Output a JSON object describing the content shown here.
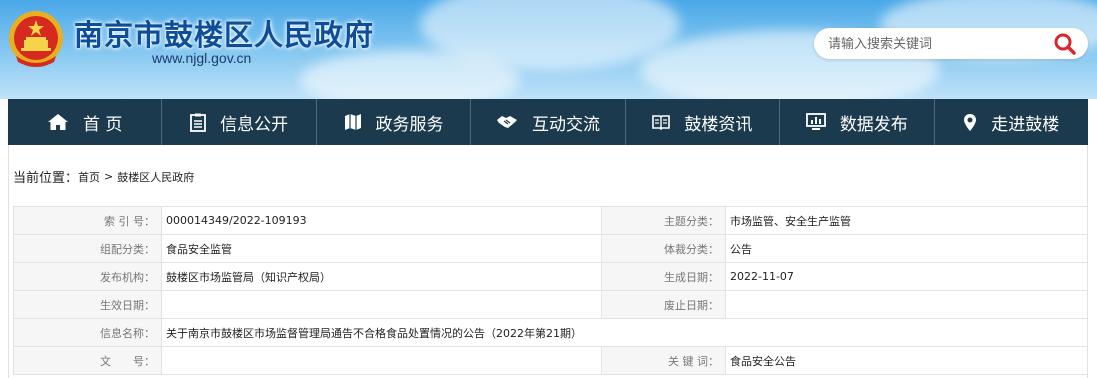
{
  "header": {
    "site_title": "南京市鼓楼区人民政府",
    "site_url": "www.njgl.gov.cn",
    "search_placeholder": "请输入搜索关键词"
  },
  "nav": {
    "items": [
      {
        "label": "首 页",
        "icon": "home-icon"
      },
      {
        "label": "信息公开",
        "icon": "document-icon"
      },
      {
        "label": "政务服务",
        "icon": "map-icon"
      },
      {
        "label": "互动交流",
        "icon": "handshake-icon"
      },
      {
        "label": "鼓楼资讯",
        "icon": "book-icon"
      },
      {
        "label": "数据发布",
        "icon": "monitor-chart-icon"
      },
      {
        "label": "走进鼓楼",
        "icon": "location-pin-icon"
      }
    ]
  },
  "breadcrumb": {
    "prefix": "当前位置：",
    "items": [
      "首页",
      "鼓楼区人民政府"
    ],
    "separator": ">"
  },
  "info": {
    "index_label": "索 引 号：",
    "index_value": "000014349/2022-109193",
    "topic_label": "主题分类：",
    "topic_value": "市场监管、安全生产监管",
    "org_cat_label": "组配分类：",
    "org_cat_value": "食品安全监管",
    "genre_label": "体裁分类：",
    "genre_value": "公告",
    "publisher_label": "发布机构：",
    "publisher_value": "鼓楼区市场监管局（知识产权局）",
    "created_label": "生成日期：",
    "created_value": "2022-11-07",
    "effective_label": "生效日期：",
    "effective_value": "",
    "expire_label": "废止日期：",
    "expire_value": "",
    "name_label": "信息名称：",
    "name_value": "关于南京市鼓楼区市场监督管理局通告不合格食品处置情况的公告（2022年第21期）",
    "docno_label": "文　　号：",
    "docno_value": "",
    "keyword_label": "关 键 词：",
    "keyword_value": "食品安全公告"
  },
  "colors": {
    "nav_bg": "#1b3a4e",
    "title_blue": "#0d4d9a",
    "search_icon_red": "#d9262c"
  }
}
